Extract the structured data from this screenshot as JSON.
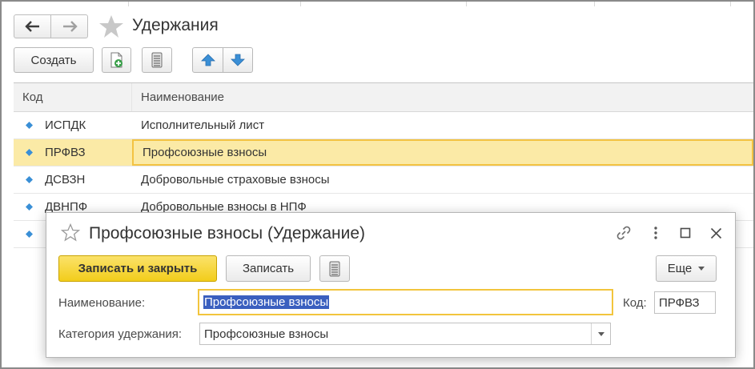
{
  "window": {
    "title": "Удержания"
  },
  "toolbar": {
    "create_label": "Создать",
    "icons": [
      "add-copy-icon",
      "list-icon",
      "move-up-icon",
      "move-down-icon"
    ]
  },
  "table": {
    "columns": [
      "Код",
      "Наименование"
    ],
    "rows": [
      {
        "code": "ИСПДК",
        "name": "Исполнительный лист"
      },
      {
        "code": "ПРФВЗ",
        "name": "Профсоюзные взносы",
        "selected": true
      },
      {
        "code": "ДСВЗН",
        "name": "Добровольные страховые взносы"
      },
      {
        "code": "ДВНПФ",
        "name": "Добровольные взносы в НПФ"
      }
    ]
  },
  "modal": {
    "title": "Профсоюзные взносы (Удержание)",
    "save_close_label": "Записать и закрыть",
    "save_label": "Записать",
    "more_label": "Еще",
    "fields": {
      "name_label": "Наименование:",
      "name_value": "Профсоюзные взносы",
      "code_label": "Код:",
      "code_value": "ПРФВЗ",
      "category_label": "Категория удержания:",
      "category_value": "Профсоюзные взносы"
    }
  },
  "colors": {
    "primary_button": "#f2cd1b",
    "selected_row": "#fbeaa6",
    "focus_border": "#f2c53d",
    "text_selection": "#3a5fbf",
    "arrow_blue": "#3a8fd6"
  }
}
